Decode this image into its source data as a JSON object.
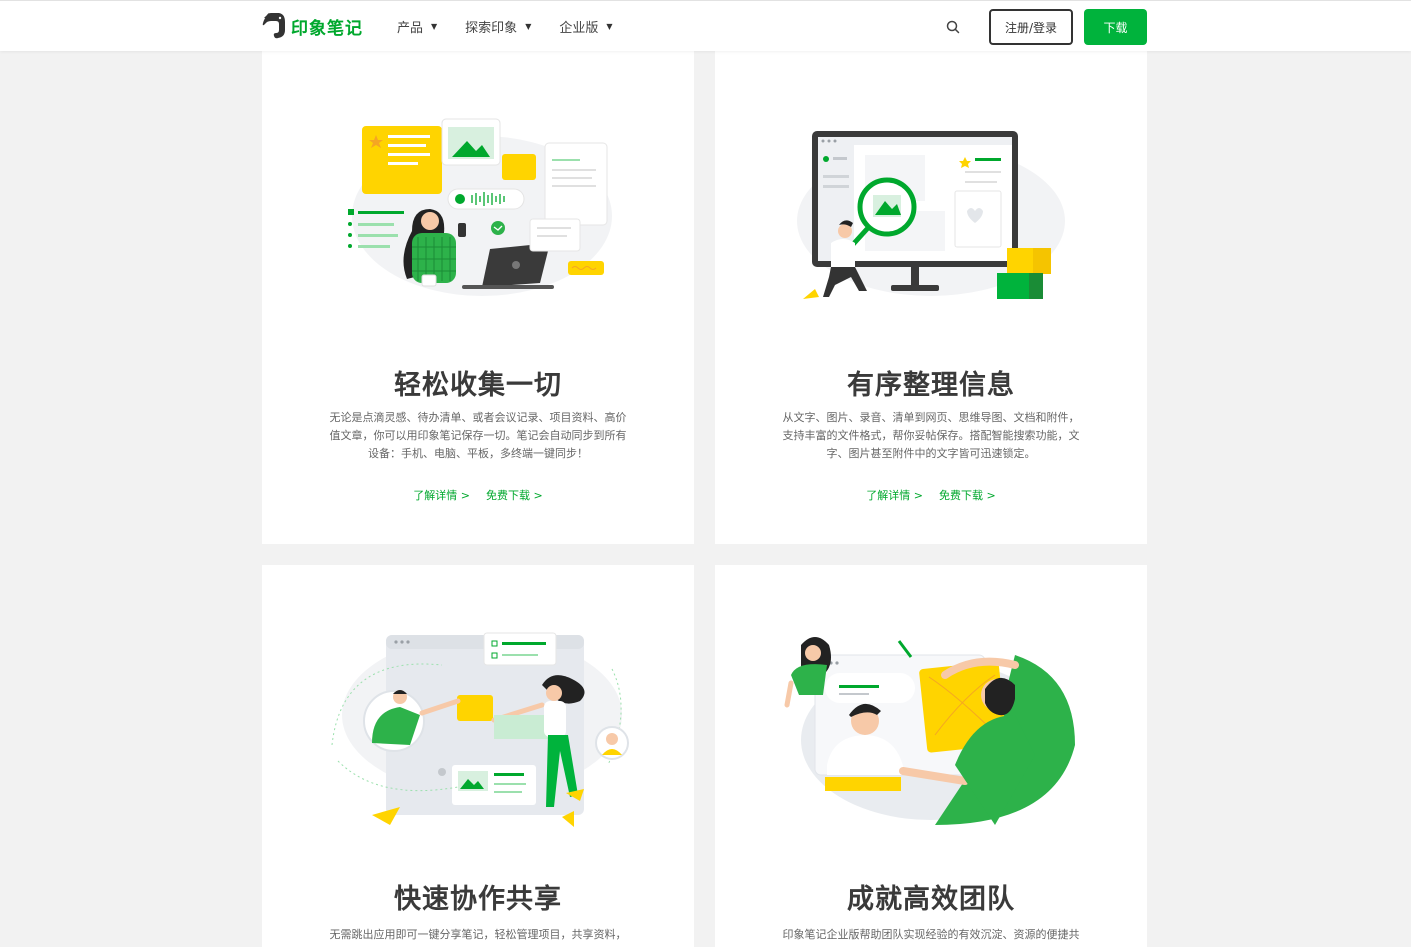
{
  "header": {
    "logo_text": "印象笔记",
    "nav": [
      {
        "label": "产品"
      },
      {
        "label": "探索印象"
      },
      {
        "label": "企业版"
      }
    ],
    "login_label": "注册/登录",
    "download_label": "下载"
  },
  "cards": [
    {
      "title": "轻松收集一切",
      "desc": "无论是点滴灵感、待办清单、或者会议记录、项目资料、高价值文章，你可以用印象笔记保存一切。笔记会自动同步到所有设备：手机、电脑、平板，多终端一键同步！",
      "link_details": "了解详情 >",
      "link_download": "免费下载 >"
    },
    {
      "title": "有序整理信息",
      "desc": "从文字、图片、录音、清单到网页、思维导图、文档和附件，支持丰富的文件格式，帮你妥帖保存。搭配智能搜索功能，文字、图片甚至附件中的文字皆可迅速锁定。",
      "link_details": "了解详情 >",
      "link_download": "免费下载 >"
    },
    {
      "title": "快速协作共享",
      "desc": "无需跳出应用即可一键分享笔记，轻松管理项目，共享资料，"
    },
    {
      "title": "成就高效团队",
      "desc": "印象笔记企业版帮助团队实现经验的有效沉淀、资源的便捷共"
    }
  ],
  "colors": {
    "brand_green": "#00a82d",
    "button_green": "#00b33c",
    "accent_yellow": "#ffd400",
    "page_bg": "#f2f2f2"
  }
}
